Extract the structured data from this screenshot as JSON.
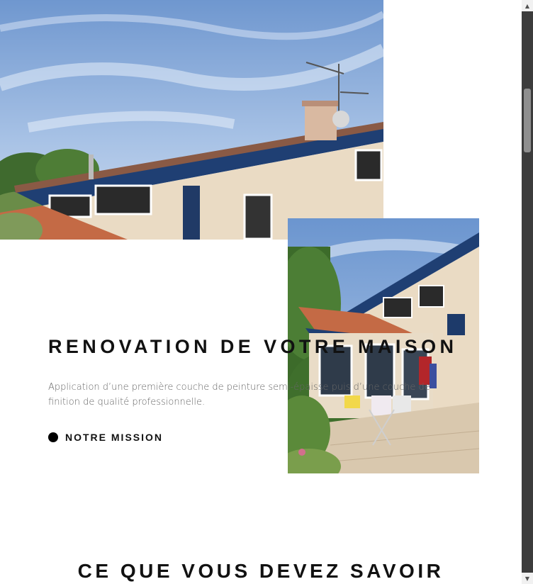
{
  "hero": {
    "image": "house-exterior-photo",
    "image_alt": "Maison rénovée avec toit en tuiles et ciel bleu"
  },
  "side_image": {
    "image": "house-terrace-photo",
    "image_alt": "Terrasse de la maison avec façade rénovée"
  },
  "section": {
    "title": "RENOVATION DE VOTRE MAISON",
    "description": "Application d’une première couche de peinture semi-épaisse puis d’une couche de finition de qualité professionnelle.",
    "mission_label": "NOTRE MISSION",
    "mission_icon": "dot-icon"
  },
  "bottom": {
    "title": "CE QUE VOUS DEVEZ SAVOIR"
  },
  "colors": {
    "text": "#111111",
    "muted": "#666666",
    "sky": "#7fa6d8",
    "roof": "#c46a45",
    "wall": "#eadbc4",
    "trim": "#1f3f73"
  }
}
